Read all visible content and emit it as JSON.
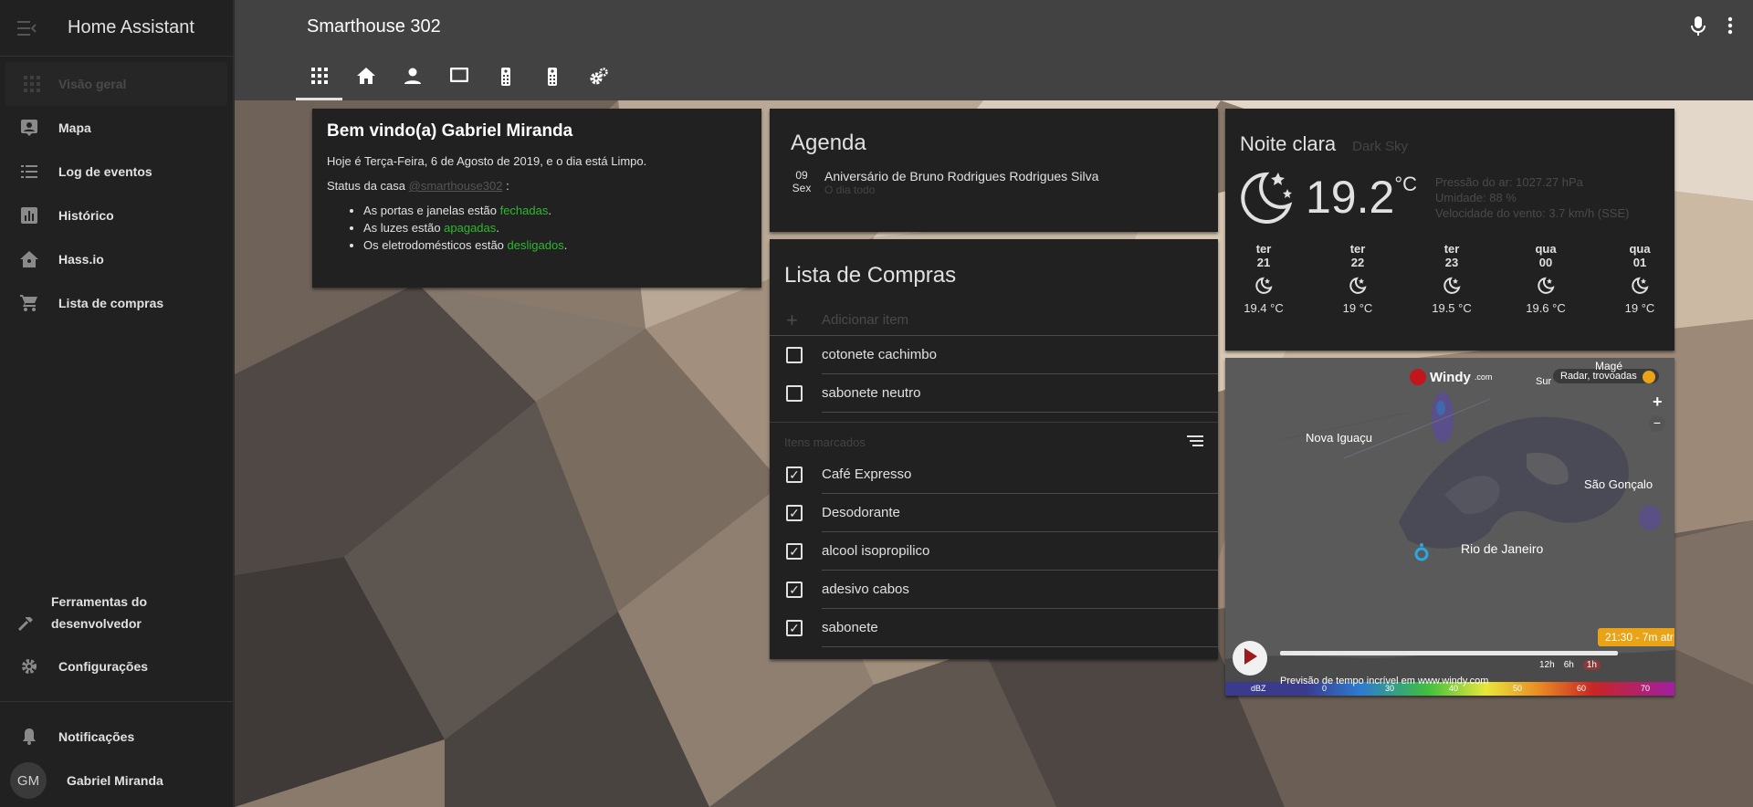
{
  "app": {
    "title": "Home Assistant",
    "page_title": "Smarthouse 302"
  },
  "sidebar": {
    "items": [
      {
        "label": "Visão geral",
        "icon": "view-dashboard-icon"
      },
      {
        "label": "Mapa",
        "icon": "account-box-icon"
      },
      {
        "label": "Log de eventos",
        "icon": "format-list-icon"
      },
      {
        "label": "Histórico",
        "icon": "chart-box-icon"
      },
      {
        "label": "Hass.io",
        "icon": "home-assistant-icon"
      },
      {
        "label": "Lista de compras",
        "icon": "cart-icon"
      }
    ],
    "dev_tools": "Ferramentas do desenvolvedor",
    "config": "Configurações",
    "notifications": "Notificações",
    "user": {
      "name": "Gabriel Miranda",
      "initials": "GM"
    }
  },
  "welcome": {
    "title": "Bem vindo(a) Gabriel Miranda",
    "line1": "Hoje é Terça-Feira, 6 de Agosto de 2019, e o dia está Limpo.",
    "status_label": "Status da casa",
    "status_link": "@smarthouse302",
    "status_colon": ":",
    "items": [
      {
        "pre": "As portas e janelas estão ",
        "val": "fechadas",
        "post": "."
      },
      {
        "pre": "As luzes estão ",
        "val": "apagadas",
        "post": "."
      },
      {
        "pre": "Os eletrodomésticos estão ",
        "val": "desligados",
        "post": "."
      }
    ]
  },
  "agenda": {
    "title": "Agenda",
    "event": {
      "day": "09",
      "weekday": "Sex",
      "title": "Aniversário de Bruno Rodrigues Rodrigues Silva",
      "sub": "O dia todo"
    }
  },
  "shopping": {
    "title": "Lista de Compras",
    "add_placeholder": "Adicionar item",
    "open_items": [
      "cotonete cachimbo",
      "sabonete neutro"
    ],
    "marked_label": "Itens marcados",
    "checked_items": [
      "Café Expresso",
      "Desodorante",
      "alcool isopropilico",
      "adesivo cabos",
      "sabonete"
    ]
  },
  "weather": {
    "name": "Noite clara",
    "source": "Dark Sky",
    "temp": "19.2",
    "unit": "°C",
    "pressure": "Pressão do ar: 1027.27 hPa",
    "humidity": "Umidade: 88 %",
    "wind": "Velocidade do vento: 3.7 km/h (SSE)",
    "forecast": [
      {
        "day": "ter",
        "hour": "21",
        "temp": "19.4 °C"
      },
      {
        "day": "ter",
        "hour": "22",
        "temp": "19 °C"
      },
      {
        "day": "ter",
        "hour": "23",
        "temp": "19.5 °C"
      },
      {
        "day": "qua",
        "hour": "00",
        "temp": "19.6 °C"
      },
      {
        "day": "qua",
        "hour": "01",
        "temp": "19 °C"
      }
    ]
  },
  "map": {
    "brand": "Windy",
    "brand_suffix": ".com",
    "layer": "Radar, trovoadas",
    "cities": [
      "Nova Iguaçu",
      "Rio de Janeiro",
      "São Gonçalo",
      "Magé",
      "Sur"
    ],
    "time_badge": "21:30 - 7m atr",
    "ranges": [
      "12h",
      "6h",
      "1h"
    ],
    "footer": "Previsão de tempo incrível em www.windy.com",
    "scale_unit": "dBZ",
    "scale": [
      "0",
      "30",
      "40",
      "50",
      "60",
      "70"
    ]
  }
}
